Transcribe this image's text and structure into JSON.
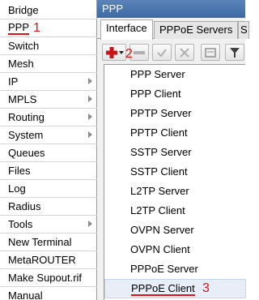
{
  "sidebar": {
    "items": [
      {
        "label": "Bridge",
        "submenu": false
      },
      {
        "label": "PPP",
        "submenu": false,
        "selected": true
      },
      {
        "label": "Switch",
        "submenu": false
      },
      {
        "label": "Mesh",
        "submenu": false
      },
      {
        "label": "IP",
        "submenu": true
      },
      {
        "label": "MPLS",
        "submenu": true
      },
      {
        "label": "Routing",
        "submenu": true
      },
      {
        "label": "System",
        "submenu": true
      },
      {
        "label": "Queues",
        "submenu": false
      },
      {
        "label": "Files",
        "submenu": false
      },
      {
        "label": "Log",
        "submenu": false
      },
      {
        "label": "Radius",
        "submenu": false
      },
      {
        "label": "Tools",
        "submenu": true
      },
      {
        "label": "New Terminal",
        "submenu": false
      },
      {
        "label": "MetaROUTER",
        "submenu": false
      },
      {
        "label": "Make Supout.rif",
        "submenu": false
      },
      {
        "label": "Manual",
        "submenu": false
      }
    ]
  },
  "window": {
    "title": "PPP",
    "tabs": [
      "Interface",
      "PPPoE Servers",
      "S"
    ],
    "active_tab": "Interface"
  },
  "toolbar": {
    "buttons": [
      "add-icon",
      "remove-icon",
      "enable-check-icon",
      "disable-x-icon",
      "comment-icon",
      "filter-icon"
    ]
  },
  "dropdown": {
    "items": [
      "PPP Server",
      "PPP Client",
      "PPTP Server",
      "PPTP Client",
      "SSTP Server",
      "SSTP Client",
      "L2TP Server",
      "L2TP Client",
      "OVPN Server",
      "OVPN Client",
      "PPPoE Server",
      "PPPoE Client"
    ],
    "highlighted": "PPPoE Client"
  },
  "annotations": {
    "step1": "1",
    "step2": "2",
    "step3": "3",
    "color": "#e01010"
  },
  "colors": {
    "titlebar": "#4a76b0",
    "accent_red": "#e01010"
  }
}
